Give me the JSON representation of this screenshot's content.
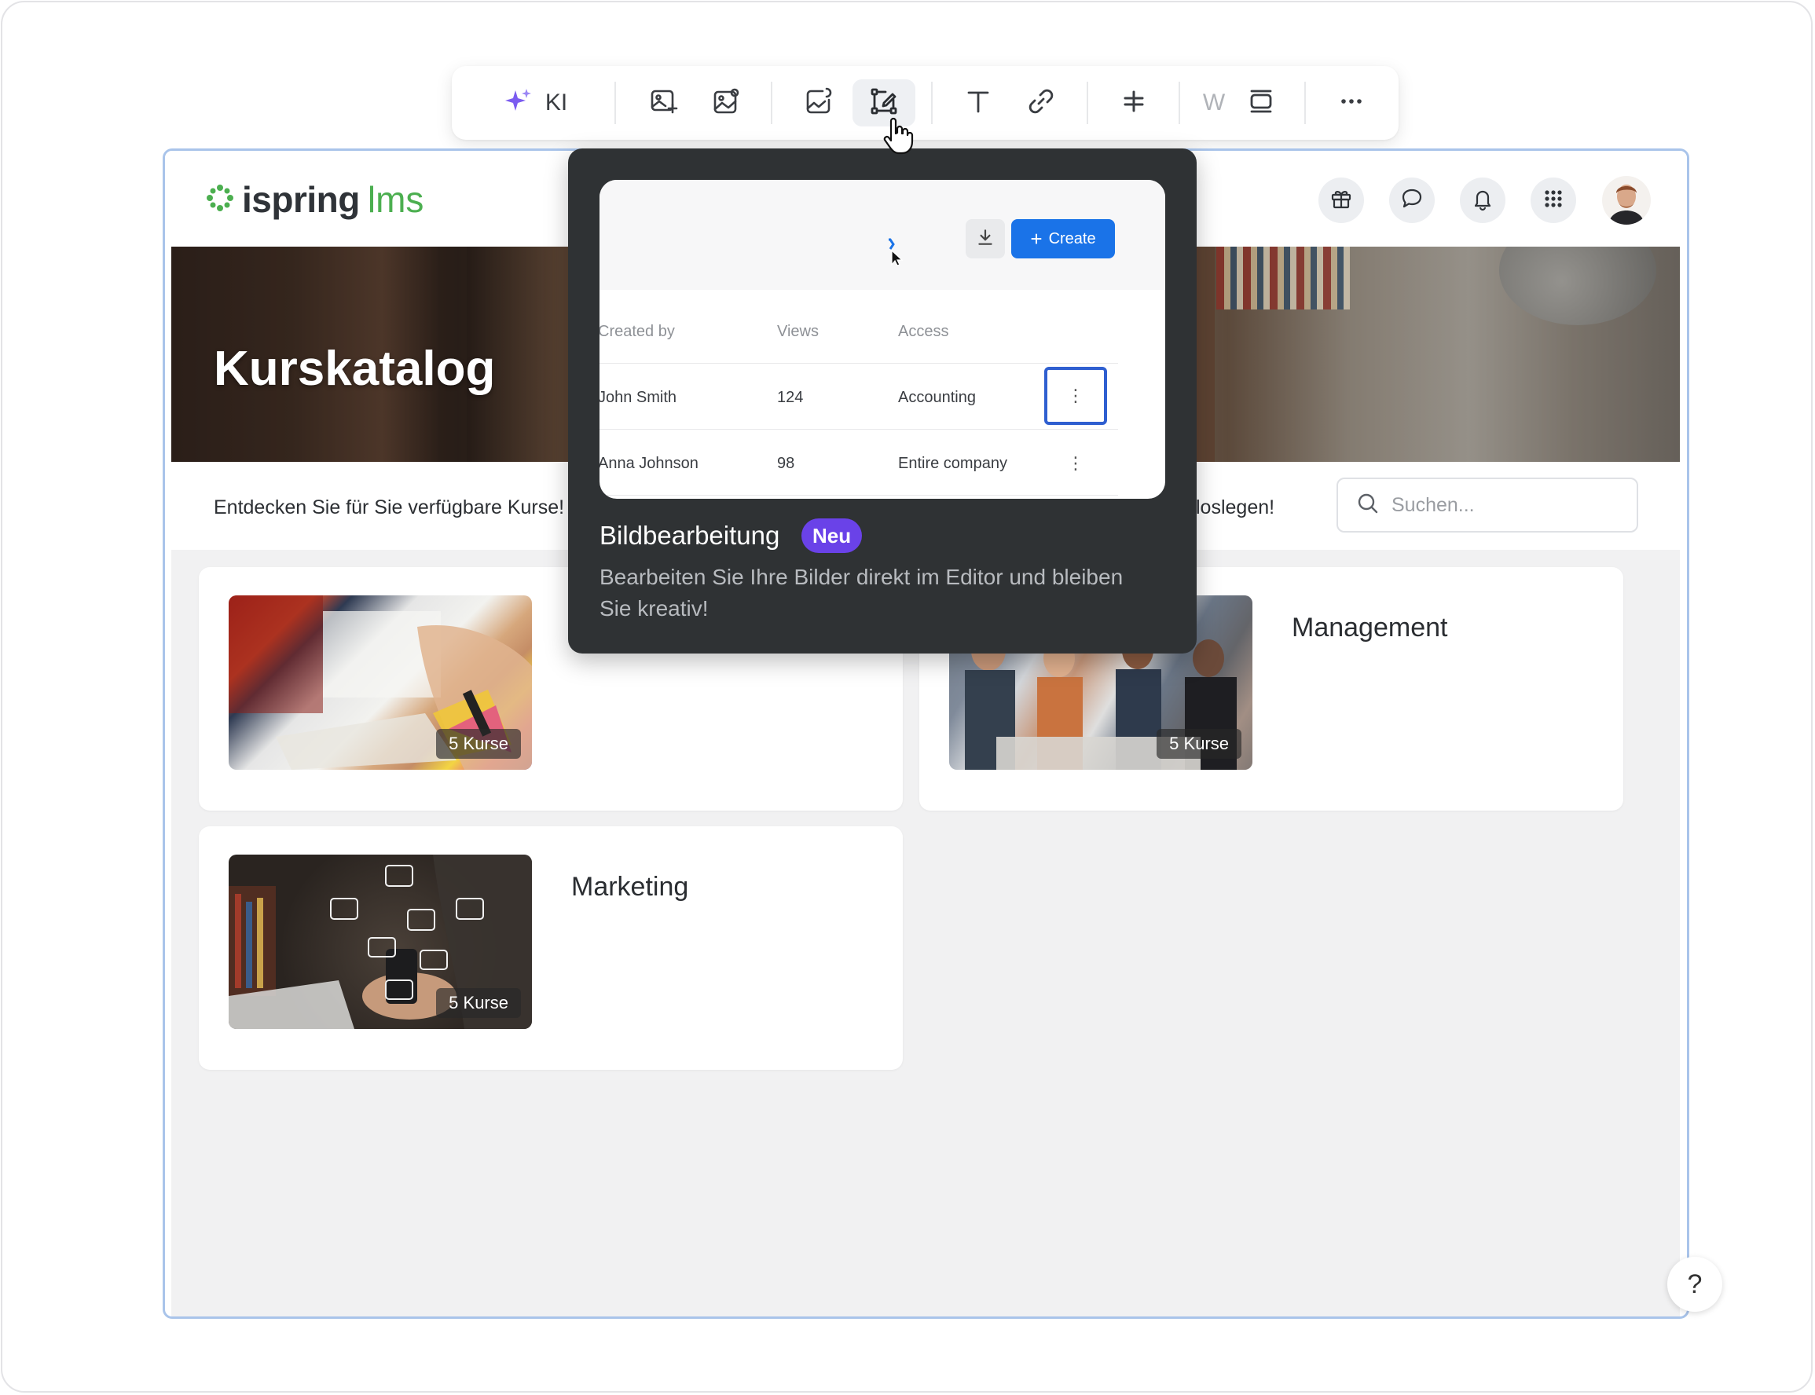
{
  "toolbar": {
    "ai_label": "KI",
    "word_label": "W",
    "more_label": "···",
    "accent": "#7b5cf0"
  },
  "app": {
    "logo_part1": "ispring",
    "logo_part2": "lms",
    "brand_color": "#4caf50",
    "banner_title": "Kurskatalog",
    "intro_left": "Entdecken Sie für Sie verfügbare Kurse!",
    "intro_right": "loslegen!",
    "search_placeholder": "Suchen...",
    "help_label": "?"
  },
  "cards": [
    {
      "title": "",
      "count": "5 Kurse"
    },
    {
      "title": "Management",
      "count": "5 Kurse"
    },
    {
      "title": "Marketing",
      "count": "5 Kurse"
    }
  ],
  "popover": {
    "title": "Bildbearbeitung",
    "badge": "Neu",
    "description": "Bearbeiten Sie Ihre Bilder direkt im Editor und bleiben Sie kreativ!",
    "preview": {
      "create_label": "Create",
      "headers": [
        "Created by",
        "Views",
        "Access"
      ],
      "rows": [
        {
          "name": "John Smith",
          "views": "124",
          "access": "Accounting"
        },
        {
          "name": "Anna Johnson",
          "views": "98",
          "access": "Entire company"
        }
      ],
      "menu_glyph": "⋮"
    }
  }
}
